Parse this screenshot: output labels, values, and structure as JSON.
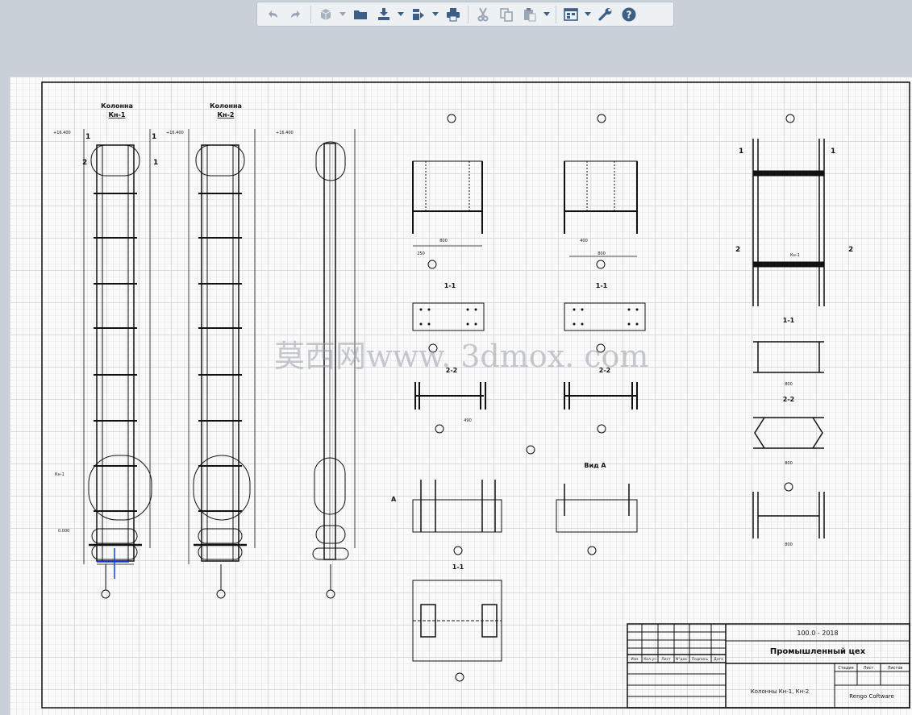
{
  "toolbar": {
    "buttons": [
      {
        "name": "undo-button",
        "icon": "undo-icon"
      },
      {
        "name": "redo-button",
        "icon": "redo-icon"
      },
      {
        "name": "view-3d-button",
        "icon": "cube-icon"
      },
      {
        "name": "open-button",
        "icon": "folder-icon"
      },
      {
        "name": "import-button",
        "icon": "import-icon"
      },
      {
        "name": "export-button",
        "icon": "export-icon"
      },
      {
        "name": "print-button",
        "icon": "printer-icon"
      },
      {
        "name": "cut-button",
        "icon": "scissors-icon"
      },
      {
        "name": "copy-button",
        "icon": "copy-icon"
      },
      {
        "name": "paste-button",
        "icon": "paste-icon"
      },
      {
        "name": "layout-button",
        "icon": "layout-icon"
      },
      {
        "name": "settings-button",
        "icon": "wrench-icon"
      },
      {
        "name": "help-button",
        "icon": "help-icon"
      }
    ]
  },
  "drawing": {
    "col1_title": "Колонна",
    "col1_id": "Кн-1",
    "col2_title": "Колонна",
    "col2_id": "Кн-2",
    "sec_1_1": "1-1",
    "sec_2_2": "2-2",
    "view_a": "Вид А",
    "watermark": "莫西网www. 3dmox. com",
    "elev_top1": "+16.400",
    "elev_top2": "+16.400",
    "elev_top3": "+16.400",
    "elev_zero": "0.000",
    "dim_800": "800",
    "dim_400": "400",
    "dim_250": "250",
    "dim_490": "490",
    "mark_kn": "Кн-1",
    "label_1": "1",
    "label_2": "2",
    "label_a": "А"
  },
  "title_block": {
    "code": "100.0 - 2018",
    "project": "Промышленный цех",
    "sheet_title": "Колонны Кн-1, Кн-2",
    "company": "Rengo Coftware",
    "col_izm": "Изм",
    "col_koluch": "Кол.уч",
    "col_list": "Лист",
    "col_ndoc": "N°док",
    "col_podpis": "Подпись",
    "col_data": "Дата",
    "stage": "Стадия",
    "sheet": "Лист",
    "sheets": "Листов"
  },
  "colors": {
    "toolbar_bg": "#eef1f4",
    "icon_blue": "#3d5f86",
    "canvas_bg": "#fafafa",
    "line": "#111111",
    "highlight": "#1a3cff"
  }
}
